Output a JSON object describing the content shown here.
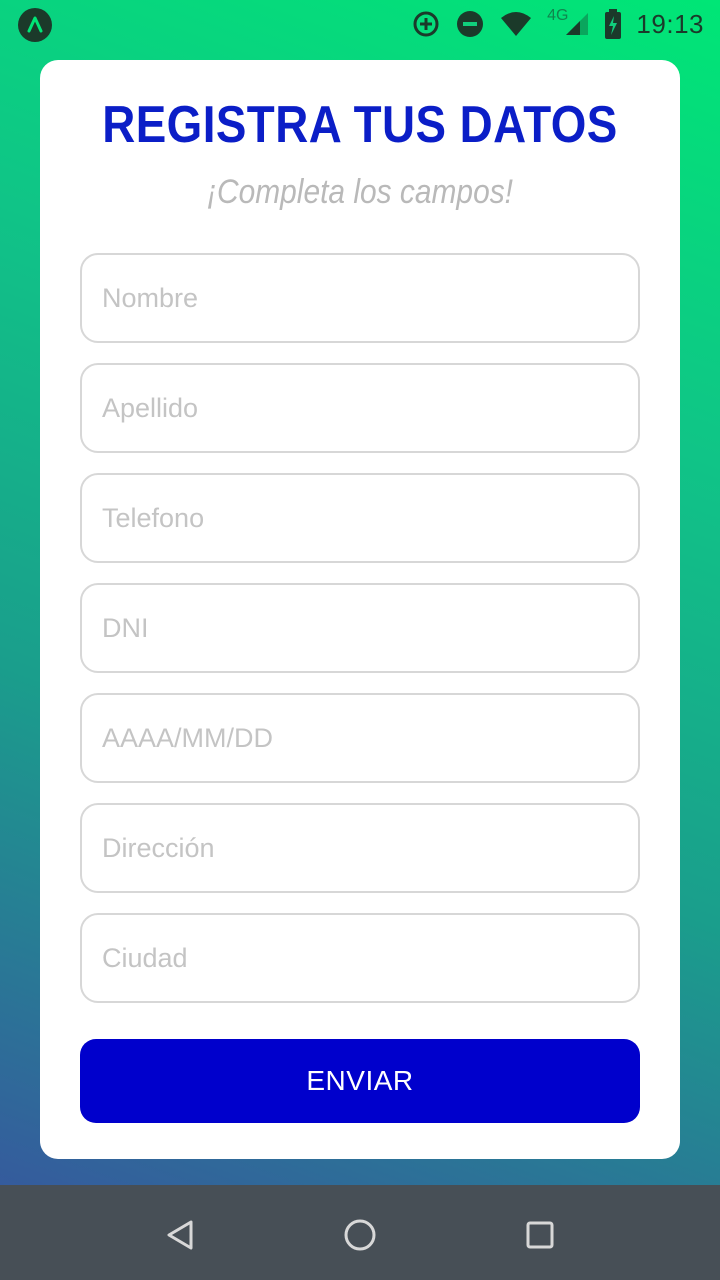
{
  "status_bar": {
    "time": "19:13",
    "network": "4G",
    "icons": [
      "app-badge-icon",
      "data-saver-icon",
      "do-not-disturb-icon",
      "wifi-icon",
      "signal-icon",
      "battery-charging-icon"
    ]
  },
  "form": {
    "title": "REGISTRA TUS DATOS",
    "subtitle": "¡Completa los campos!",
    "fields": {
      "nombre": {
        "placeholder": "Nombre",
        "value": ""
      },
      "apellido": {
        "placeholder": "Apellido",
        "value": ""
      },
      "telefono": {
        "placeholder": "Telefono",
        "value": ""
      },
      "dni": {
        "placeholder": "DNI",
        "value": ""
      },
      "fecha": {
        "placeholder": "AAAA/MM/DD",
        "value": ""
      },
      "direccion": {
        "placeholder": "Dirección",
        "value": ""
      },
      "ciudad": {
        "placeholder": "Ciudad",
        "value": ""
      }
    },
    "submit_label": "ENVIAR"
  },
  "nav_bar": {
    "icons": [
      "back-icon",
      "home-icon",
      "recents-icon"
    ]
  },
  "colors": {
    "title": "#0b1ec7",
    "button": "#0000cc",
    "background_top": "#00e676",
    "background_bottom": "#3a4fa0",
    "nav_bar": "#474f56"
  }
}
